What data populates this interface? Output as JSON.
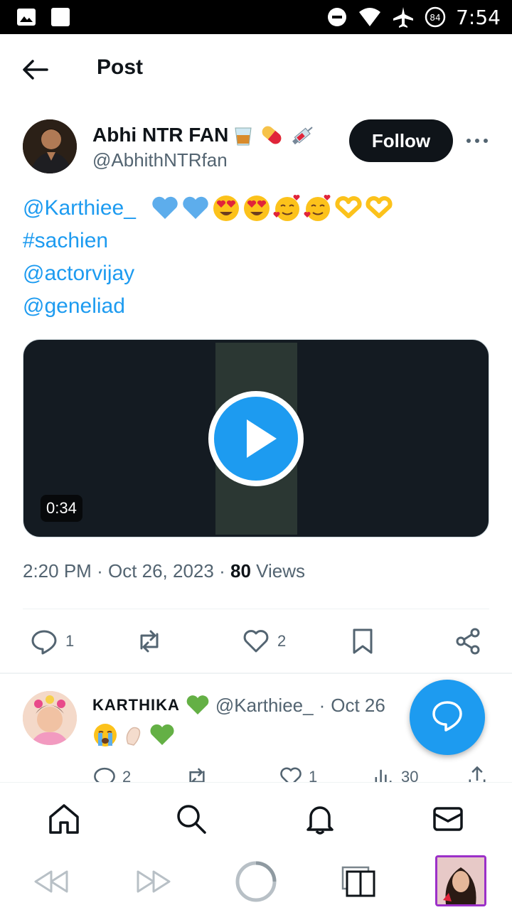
{
  "status_bar": {
    "time": "7:54",
    "battery_level": "84",
    "icons": [
      "image-icon",
      "square-icon",
      "dnd-icon",
      "wifi-icon",
      "airplane-icon",
      "battery-icon"
    ]
  },
  "header": {
    "title": "Post"
  },
  "author": {
    "name": "Abhi NTR FAN",
    "handle": "@AbhithNTRfan",
    "follow_label": "Follow",
    "name_emojis": [
      "tumbler-glass",
      "pill",
      "syringe"
    ]
  },
  "tweet": {
    "lines": [
      "@Karthiee_",
      "#sachien",
      "@actorvijay",
      "@geneliad"
    ],
    "line1_emojis": [
      "blue-heart",
      "blue-heart",
      "heart-eyes",
      "heart-eyes",
      "smiling-face-hearts",
      "smiling-face-hearts",
      "heart-hands",
      "heart-hands"
    ],
    "video_duration": "0:34"
  },
  "meta": {
    "time": "2:20 PM",
    "date": "Oct 26, 2023",
    "separator": "·",
    "views_count": "80",
    "views_label": "Views"
  },
  "actions": {
    "reply_count": "1",
    "retweet_count": "",
    "like_count": "2"
  },
  "reply": {
    "name": "KARTHIKA",
    "handle": "@Karthiee_",
    "date": "Oct 26",
    "emojis": [
      "loudly-crying",
      "pinching-hand",
      "green-heart"
    ],
    "reply_count": "2",
    "like_count": "1",
    "views_count": "30"
  },
  "colors": {
    "accent": "#1d9bf0",
    "text": "#0f1419",
    "muted": "#536471",
    "follow_bg": "#0f1419"
  }
}
